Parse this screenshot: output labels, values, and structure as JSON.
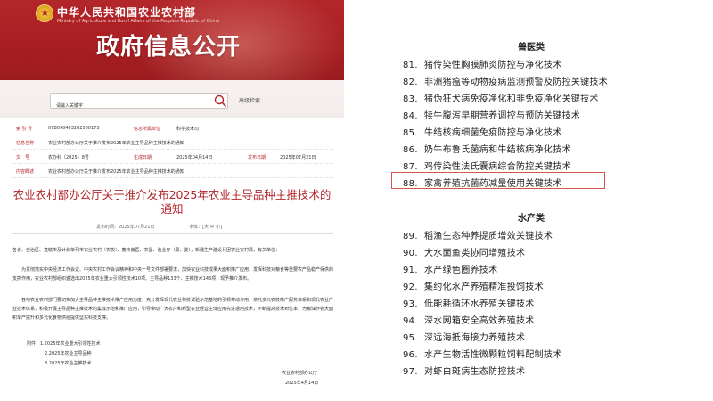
{
  "header": {
    "ministry_name": "中华人民共和国农业农村部",
    "ministry_en": "Ministry of Agriculture and Rural Affairs of the People's Republic of China",
    "page_heading": "政府信息公开"
  },
  "search": {
    "value": "请输入关键字",
    "advanced_label": "高级检索"
  },
  "meta": {
    "index_label": "索 引 号",
    "index_value": "07B090403202500173",
    "category_label": "信息所属单位",
    "category_value": "科学技术司",
    "name_label": "信息名称",
    "name_value": "农业农村部办公厅关于推介发布2025年农业主导品种主推技术的通知",
    "doc_label": "文　号",
    "doc_value": "农办科〔2025〕8号",
    "gen_label": "生成日期",
    "gen_value": "2025年04月14日",
    "pub_label": "发布日期",
    "pub_value": "2025年07月21日",
    "summary_label": "内容概述",
    "summary_value": "农业农村部办公厅关于推介发布2025年农业主导品种主推技术的通知"
  },
  "article": {
    "title_line1": "农业农村部办公厅关于推介发布2025年农业主导品种主推技术的",
    "title_line2": "通知",
    "publish_time": "发布时间：2025年07月21日",
    "font_size": "字体：[大 中 小]",
    "para1": "各省、自治区、直辖市及计划单列市农业农村（农牧）、畜牧兽医、农垦、渔业厅（局、委），新疆生产建设兵团农业农村局，有关单位：",
    "para2": "为贯彻落实中央经济工作会议、中央农村工作会议精神和中央一号文件部署要求，加快农业科技成果大面积推广应用，发挥科技对粮食等重要农产品稳产保供的支撑作用，农业农村部组织遴选出2025年农业重大引领性技术10项、主导品种133个、主推技术143项，现予推介发布。",
    "para3": "各地农业农村部门要切实加大主导品种主推技术推广应用力度，充分发挥现代农业科技试验示范基地的引领带动作用，依托多元农技推广服务体系和现代农业产业技术体系，积极开展主导品种主推技术的集成示范和推广应用，引导带动广大农户和新型农业经营主体应用先进适用技术，不断提高技术到位率，为粮油作物大面积单产提升和多元化食物供给提供坚实科技支撑。",
    "attach_label": "附件：1.2025年农业重大引领性技术",
    "attach_2": "2.2025年农业主导品种",
    "attach_3": "3.2025年农业主推技术",
    "signer": "农业农村部办公厅",
    "sign_date": "2025年4月14日"
  },
  "right": {
    "vet_heading": "兽医类",
    "vet_items": [
      {
        "num": "81.",
        "text": "猪传染性胸膜肺炎防控与净化技术"
      },
      {
        "num": "82.",
        "text": "非洲猪瘟等动物疫病监测预警及防控关键技术"
      },
      {
        "num": "83.",
        "text": "猪伪狂犬病免疫净化和非免疫净化关键技术"
      },
      {
        "num": "84.",
        "text": "犊牛腹泻早期营养调控与预防关键技术"
      },
      {
        "num": "85.",
        "text": "牛结核病细菌免疫防控与净化技术"
      },
      {
        "num": "86.",
        "text": "奶牛布鲁氏菌病和牛结核病净化技术"
      },
      {
        "num": "87.",
        "text": "鸡传染性法氏囊病综合防控关键技术"
      },
      {
        "num": "88.",
        "text": "家禽养殖抗菌药减量使用关键技术"
      }
    ],
    "aqua_heading": "水产类",
    "aqua_items": [
      {
        "num": "89.",
        "text": "稻渔生态种养提质增效关键技术"
      },
      {
        "num": "90.",
        "text": "大水面鱼类协同增殖技术"
      },
      {
        "num": "91.",
        "text": "水产绿色圈养技术"
      },
      {
        "num": "92.",
        "text": "集约化水产养殖精准投饲技术"
      },
      {
        "num": "93.",
        "text": "低能耗循环水养殖关键技术"
      },
      {
        "num": "94.",
        "text": "深水网箱安全高效养殖技术"
      },
      {
        "num": "95.",
        "text": "深远海抵海接力养殖技术"
      },
      {
        "num": "96.",
        "text": "水产生物活性微颗粒饲料配制技术"
      },
      {
        "num": "97.",
        "text": "对虾白斑病生态防控技术"
      }
    ],
    "highlight_color": "#d9534f"
  }
}
